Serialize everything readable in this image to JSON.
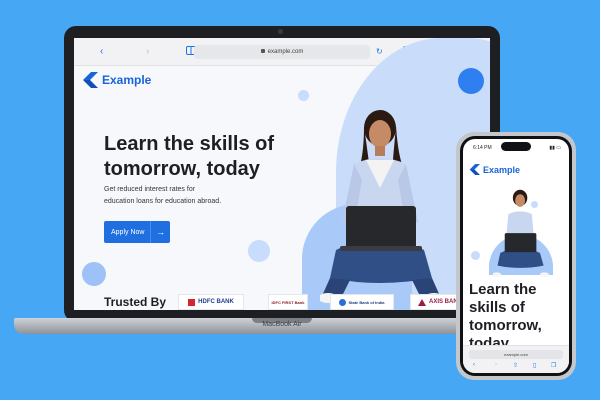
{
  "laptop": {
    "model_label": "MacBook Air",
    "browser": {
      "url": "example.com"
    },
    "site": {
      "brand": "Example",
      "hero_title": "Learn the skills of tomorrow, today",
      "hero_subtitle": "Get reduced interest rates for education loans for education abroad.",
      "cta_label": "Apply Now",
      "trusted_label": "Trusted By",
      "partners": [
        "HDFC BANK",
        "IDFC FIRST Bank",
        "State Bank of India",
        "AXIS BANK"
      ]
    }
  },
  "phone": {
    "status_time": "6:14 PM",
    "brand": "Example",
    "hero_title": "Learn the skills of tomorrow, today",
    "url": "example.com"
  },
  "colors": {
    "background": "#46a8f4",
    "brand": "#1964d8",
    "button": "#1f6fe0",
    "circle_light": "#c8dcfb",
    "circle_dark": "#2f7ff0"
  },
  "icons": {
    "browser_toolbar": [
      "chevron-left-icon",
      "chevron-right-icon",
      "sidebar-icon",
      "reload-icon",
      "share-icon",
      "plus-icon",
      "tabs-icon"
    ]
  }
}
